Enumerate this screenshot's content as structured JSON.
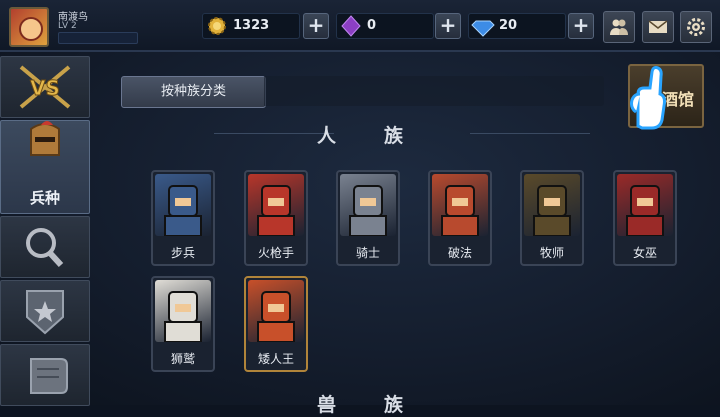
{
  "player": {
    "name": "南渡鸟",
    "level": "LV 2",
    "xp_fraction": 0.0
  },
  "resources": [
    {
      "icon": "gold-gear-icon",
      "value": "1323"
    },
    {
      "icon": "purple-crystal-icon",
      "value": "0"
    },
    {
      "icon": "blue-diamond-icon",
      "value": "20"
    }
  ],
  "top_buttons": [
    "friends-icon",
    "mail-icon",
    "settings-gear-icon"
  ],
  "sidebar": [
    {
      "icon": "vs-swords-icon",
      "label": ""
    },
    {
      "icon": "helmet-icon",
      "label": "兵种",
      "active": true
    },
    {
      "icon": "magnifier-icon",
      "label": ""
    },
    {
      "icon": "shield-banner-icon",
      "label": ""
    },
    {
      "icon": "scroll-icon",
      "label": ""
    }
  ],
  "filter_button": "按种族分类",
  "tavern_label": "酒馆",
  "sections": {
    "human": "人族",
    "beast": "兽族"
  },
  "human_units": [
    {
      "name": "步兵",
      "color": "#3a5a8a"
    },
    {
      "name": "火枪手",
      "color": "#b8362a"
    },
    {
      "name": "骑士",
      "color": "#7a8290"
    },
    {
      "name": "破法",
      "color": "#b84a2e"
    },
    {
      "name": "牧师",
      "color": "#5a4a2a"
    },
    {
      "name": "女巫",
      "color": "#9a2a28"
    },
    {
      "name": "狮鹫",
      "color": "#e0ddd6"
    },
    {
      "name": "矮人王",
      "color": "#c8502a",
      "rare": true
    }
  ]
}
